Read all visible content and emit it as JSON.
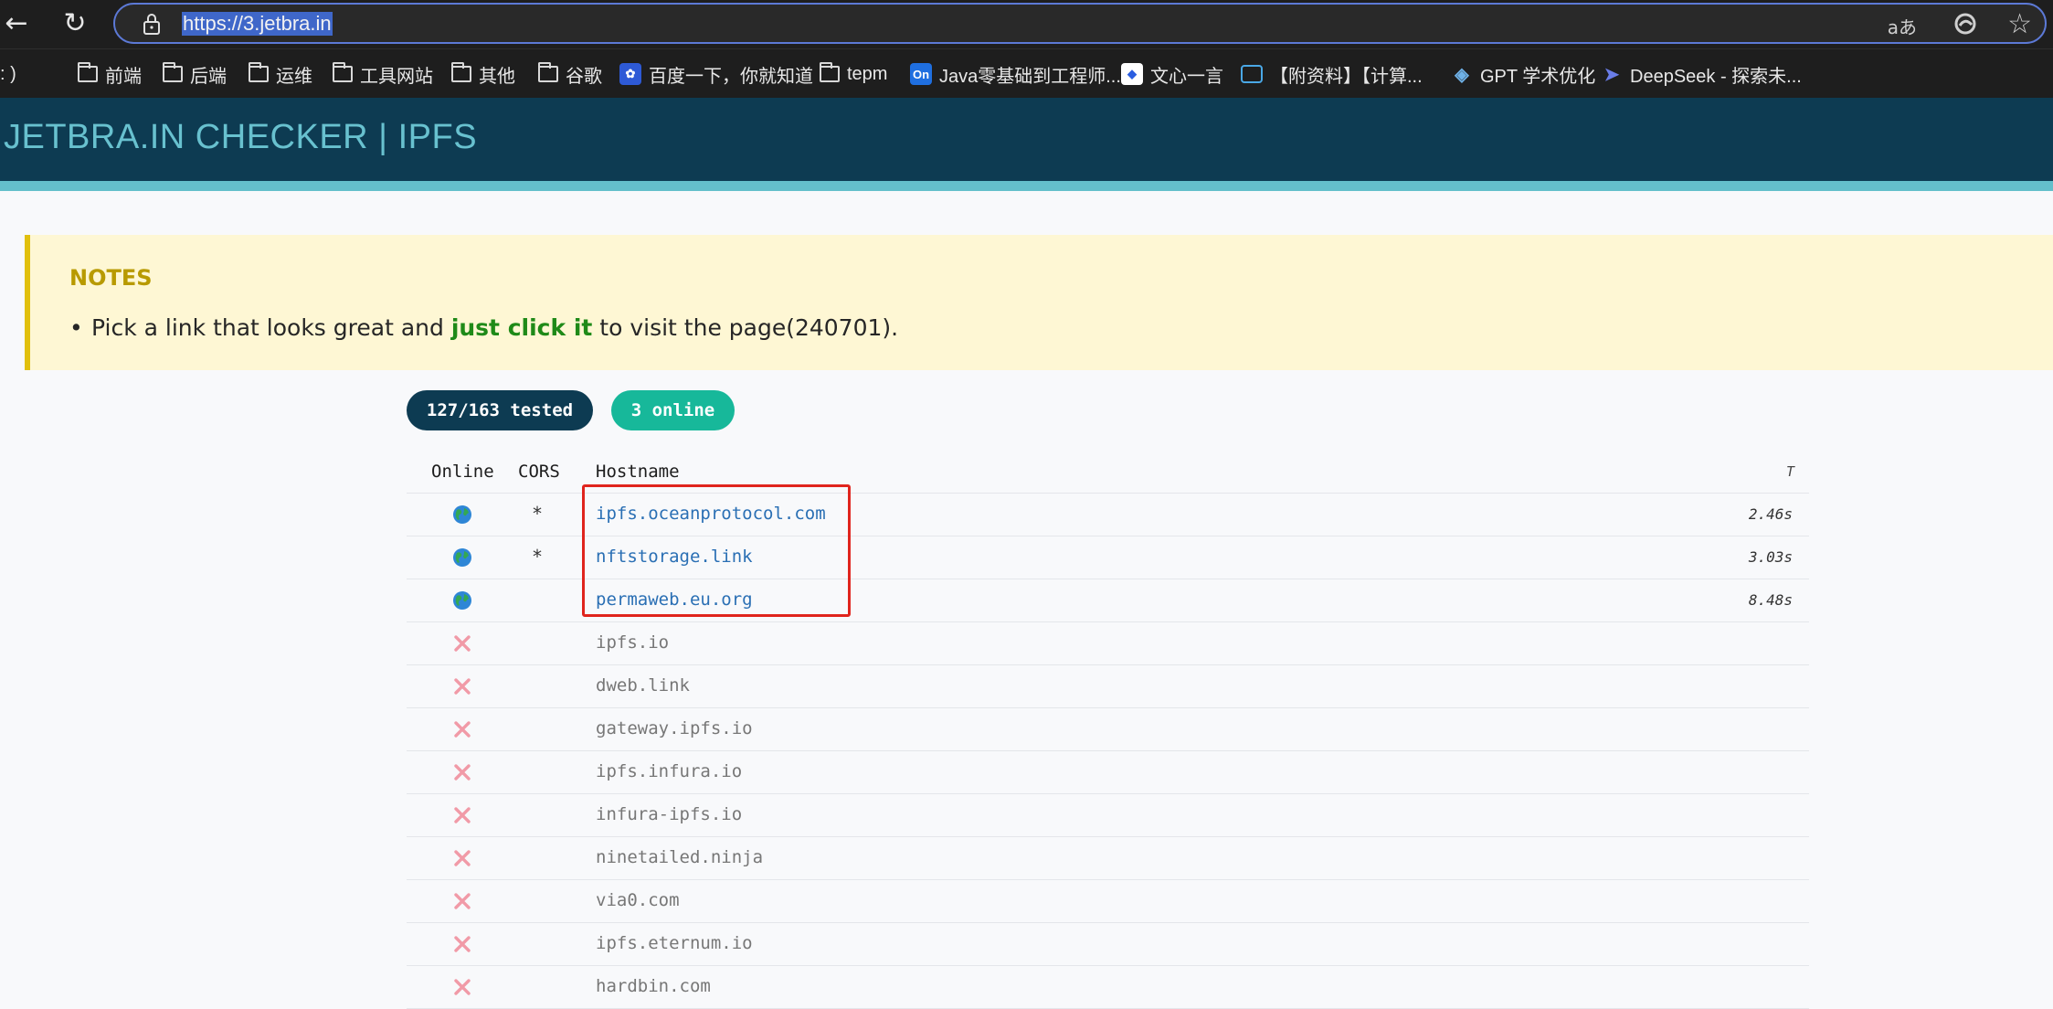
{
  "browser": {
    "url": "https://3.jetbra.in",
    "read_aloud_glyph": "aあ",
    "icons": [
      "back-arrow-icon",
      "reload-icon",
      "lock-icon",
      "read-aloud-icon",
      "edge-icon",
      "favorite-star-icon"
    ]
  },
  "bookmarks": [
    {
      "label": ": )",
      "icon": "folder-icon"
    },
    {
      "label": "前端",
      "icon": "folder-icon"
    },
    {
      "label": "后端",
      "icon": "folder-icon"
    },
    {
      "label": "运维",
      "icon": "folder-icon"
    },
    {
      "label": "工具网站",
      "icon": "folder-icon"
    },
    {
      "label": "其他",
      "icon": "folder-icon"
    },
    {
      "label": "谷歌",
      "icon": "folder-icon"
    },
    {
      "label": "百度一下，你就知道",
      "icon": "baidu-icon"
    },
    {
      "label": "tepm",
      "icon": "folder-icon"
    },
    {
      "label": "Java零基础到工程师...",
      "icon": "oneline-icon",
      "icon_text": "On"
    },
    {
      "label": "文心一言",
      "icon": "wenxin-icon"
    },
    {
      "label": "【附资料】【计算...",
      "icon": "bilibili-icon"
    },
    {
      "label": "GPT 学术优化",
      "icon": "gpt-icon"
    },
    {
      "label": "DeepSeek - 探索未...",
      "icon": "deepseek-icon"
    }
  ],
  "header": {
    "title": "JETBRA.IN CHECKER | IPFS",
    "colors": {
      "background": "#0d3b52",
      "title": "#68c1cf",
      "stripe": "#64bfcb"
    }
  },
  "notes": {
    "title": "NOTES",
    "text_before": "Pick a link that looks great and ",
    "emphasis": "just click it",
    "text_after": " to visit the page(240701)."
  },
  "badges": {
    "tested": "127/163 tested",
    "online": "3 online"
  },
  "table": {
    "headers": {
      "online": "Online",
      "cors": "CORS",
      "hostname": "Hostname",
      "time": "T"
    },
    "rows": [
      {
        "online": true,
        "cors": "*",
        "hostname": "ipfs.oceanprotocol.com",
        "time": "2.46s"
      },
      {
        "online": true,
        "cors": "*",
        "hostname": "nftstorage.link",
        "time": "3.03s"
      },
      {
        "online": true,
        "cors": "",
        "hostname": "permaweb.eu.org",
        "time": "8.48s"
      },
      {
        "online": false,
        "cors": "",
        "hostname": "ipfs.io",
        "time": ""
      },
      {
        "online": false,
        "cors": "",
        "hostname": "dweb.link",
        "time": ""
      },
      {
        "online": false,
        "cors": "",
        "hostname": "gateway.ipfs.io",
        "time": ""
      },
      {
        "online": false,
        "cors": "",
        "hostname": "ipfs.infura.io",
        "time": ""
      },
      {
        "online": false,
        "cors": "",
        "hostname": "infura-ipfs.io",
        "time": ""
      },
      {
        "online": false,
        "cors": "",
        "hostname": "ninetailed.ninja",
        "time": ""
      },
      {
        "online": false,
        "cors": "",
        "hostname": "via0.com",
        "time": ""
      },
      {
        "online": false,
        "cors": "",
        "hostname": "ipfs.eternum.io",
        "time": ""
      },
      {
        "online": false,
        "cors": "",
        "hostname": "hardbin.com",
        "time": ""
      }
    ]
  },
  "colors": {
    "online_link": "#2a6fb4",
    "offline_text": "#777777",
    "offline_mark": "#f19aa7",
    "highlight": "#e0241d"
  }
}
